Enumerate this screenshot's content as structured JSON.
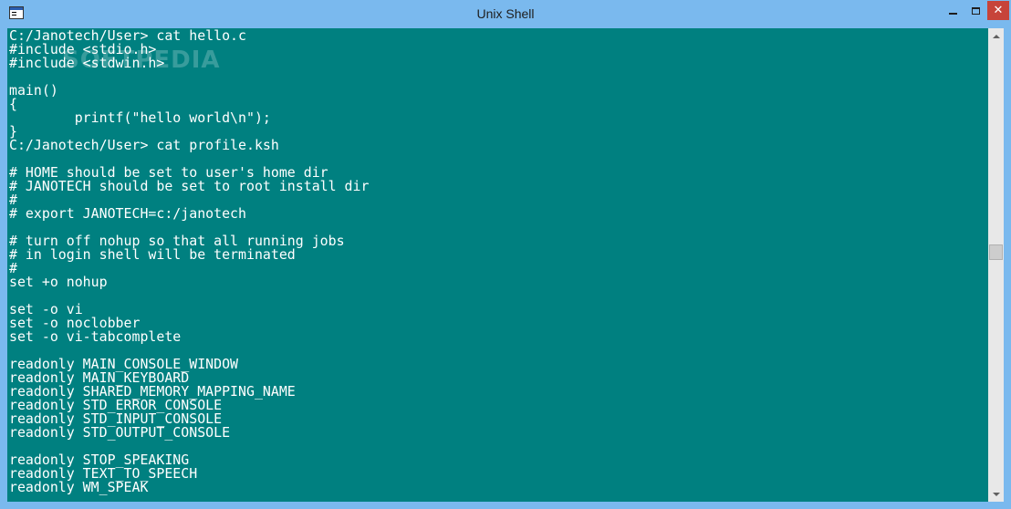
{
  "window": {
    "title": "Unix Shell",
    "icon": "terminal-app-icon",
    "controls": {
      "minimize": "minimize-icon",
      "maximize": "maximize-icon",
      "close": "close-icon",
      "close_glyph": "✕"
    }
  },
  "colors": {
    "terminal_bg": "#008080",
    "terminal_fg": "#ffffff",
    "titlebar": "#7ab9ee",
    "close_button": "#c7443a"
  },
  "watermark": "SOFTPEDIA",
  "terminal": {
    "lines": [
      "C:/Janotech/User> cat hello.c",
      "#include <stdio.h>",
      "#include <stdwin.h>",
      "",
      "main()",
      "{",
      "        printf(\"hello world\\n\");",
      "}",
      "C:/Janotech/User> cat profile.ksh",
      "",
      "# HOME should be set to user's home dir",
      "# JANOTECH should be set to root install dir",
      "#",
      "# export JANOTECH=c:/janotech",
      "",
      "# turn off nohup so that all running jobs",
      "# in login shell will be terminated",
      "#",
      "set +o nohup",
      "",
      "set -o vi",
      "set -o noclobber",
      "set -o vi-tabcomplete",
      "",
      "readonly MAIN_CONSOLE_WINDOW",
      "readonly MAIN_KEYBOARD",
      "readonly SHARED_MEMORY_MAPPING_NAME",
      "readonly STD_ERROR_CONSOLE",
      "readonly STD_INPUT_CONSOLE",
      "readonly STD_OUTPUT_CONSOLE",
      "",
      "readonly STOP_SPEAKING",
      "readonly TEXT_TO_SPEECH",
      "readonly WM_SPEAK"
    ]
  },
  "scrollbar": {
    "position": 0.47
  }
}
